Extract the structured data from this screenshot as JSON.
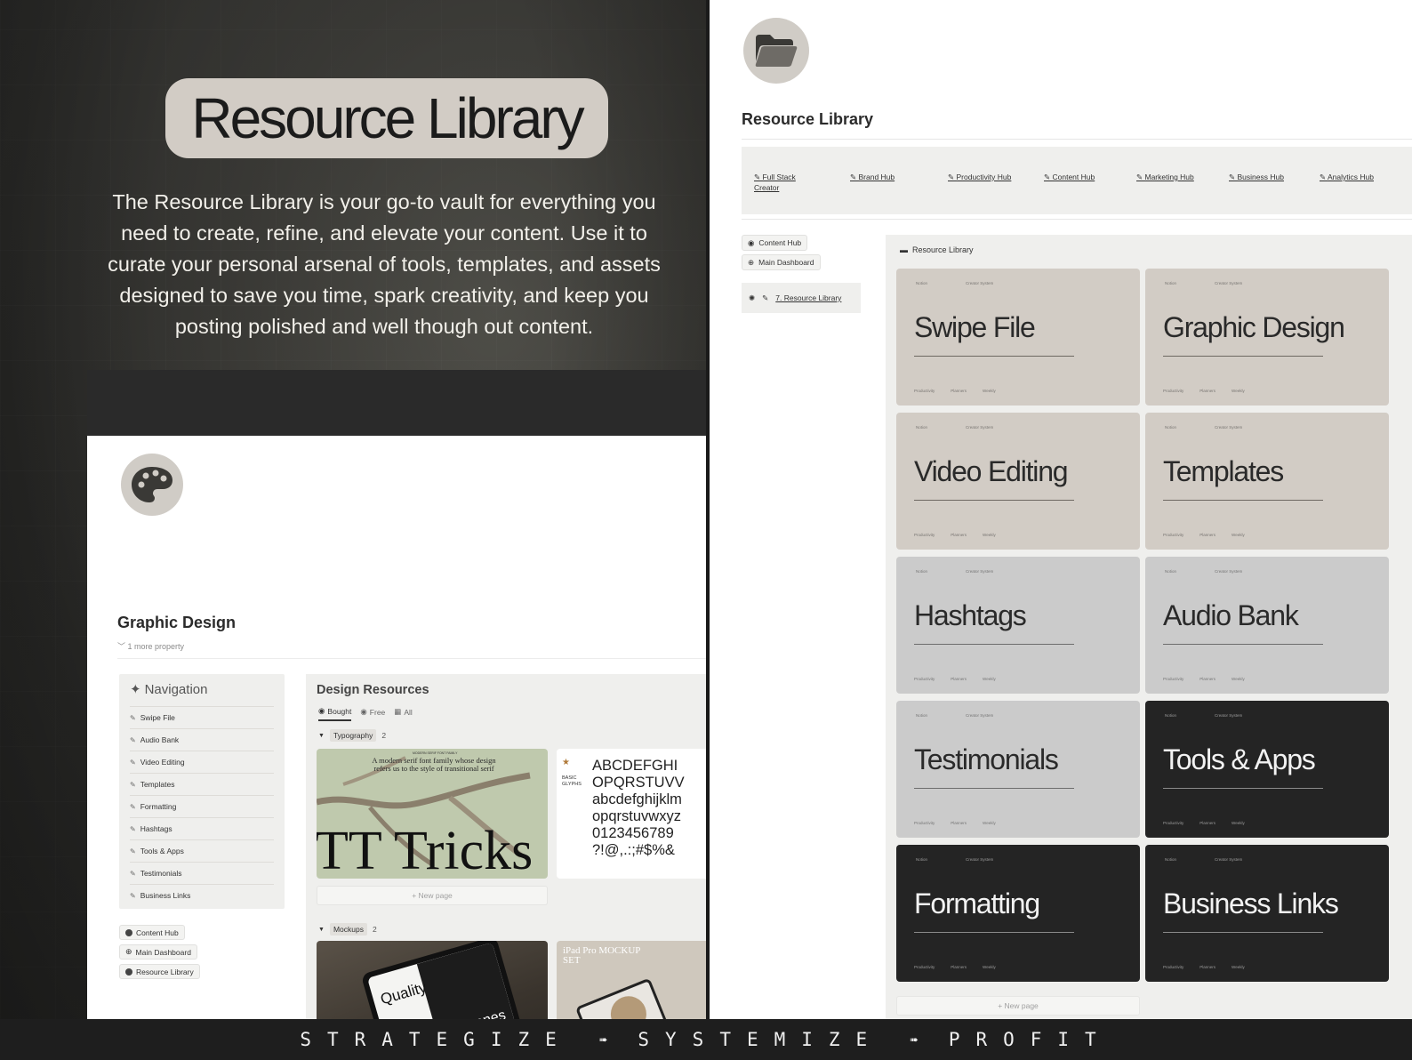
{
  "hero": {
    "title": "Resource Library",
    "description": "The Resource Library is your go-to vault for everything you need to create, refine, and elevate your content. Use it to curate your personal arsenal of tools, templates, and assets designed to save you time, spark creativity, and keep you posting polished and well though out content."
  },
  "graphic_design": {
    "title": "Graphic Design",
    "property": "1 more property",
    "nav_title": "Navigation",
    "nav_items": [
      "Swipe File",
      "Audio Bank",
      "Video Editing",
      "Templates",
      "Formatting",
      "Hashtags",
      "Tools & Apps",
      "Testimonials",
      "Business Links"
    ],
    "links": [
      "Content Hub",
      "Main Dashboard",
      "Resource Library"
    ],
    "resources": {
      "title": "Design Resources",
      "tabs": [
        "Bought",
        "Free",
        "All"
      ],
      "groups": [
        {
          "name": "Typography",
          "count": "2"
        },
        {
          "name": "Mockups",
          "count": "2"
        }
      ],
      "new_page": "+ New page",
      "cards": {
        "typo1_small": "MODERN SERIF FONT FAMILY",
        "typo1_desc": "A modern serif font family whose design refers us to the style of transitional serif",
        "typo1_big": "TT Tricks",
        "typo2_label": "BASIC GLYPHS",
        "typo2_lines": [
          "ABCDEFGHI",
          "OPQRSTUVV",
          "abcdefghijklm",
          "opqrstuvwxyz",
          "0123456789",
          "?!@,.:;#$%&"
        ],
        "mock1_word1": "Quality",
        "mock1_word2": "Scenes",
        "mock2_title": "iPad Pro MOCKUP SET"
      }
    }
  },
  "resource_library": {
    "title": "Resource Library",
    "hubs": [
      "Full Stack Creator",
      "Brand Hub",
      "Productivity Hub",
      "Content Hub",
      "Marketing Hub",
      "Business Hub",
      "Analytics Hub"
    ],
    "links": [
      "Content Hub",
      "Main Dashboard"
    ],
    "breadcrumb": "7. Resource Library",
    "gallery_title": "Resource Library",
    "tile_meta": {
      "left": "Notion",
      "right": "Creator System",
      "foot1": "Productivity",
      "foot2": "Planners",
      "foot3": "Weekly"
    },
    "tiles": [
      {
        "name": "Swipe File",
        "style": "warm"
      },
      {
        "name": "Graphic Design",
        "style": "warm"
      },
      {
        "name": "Video Editing",
        "style": "warm"
      },
      {
        "name": "Templates",
        "style": "warm"
      },
      {
        "name": "Hashtags",
        "style": "grey"
      },
      {
        "name": "Audio Bank",
        "style": "grey"
      },
      {
        "name": "Testimonials",
        "style": "grey"
      },
      {
        "name": "Tools & Apps",
        "style": "dark"
      },
      {
        "name": "Formatting",
        "style": "dark"
      },
      {
        "name": "Business Links",
        "style": "dark"
      }
    ],
    "new_page": "+ New page"
  },
  "footer": {
    "words": [
      "STRATEGIZE",
      "SYSTEMIZE",
      "PROFIT"
    ],
    "arrow": "➠"
  },
  "colors": {
    "warm_tile": "#d2ccc5",
    "grey_tile": "#cbcbcb",
    "dark_tile": "#242424",
    "panel": "#efefed"
  }
}
